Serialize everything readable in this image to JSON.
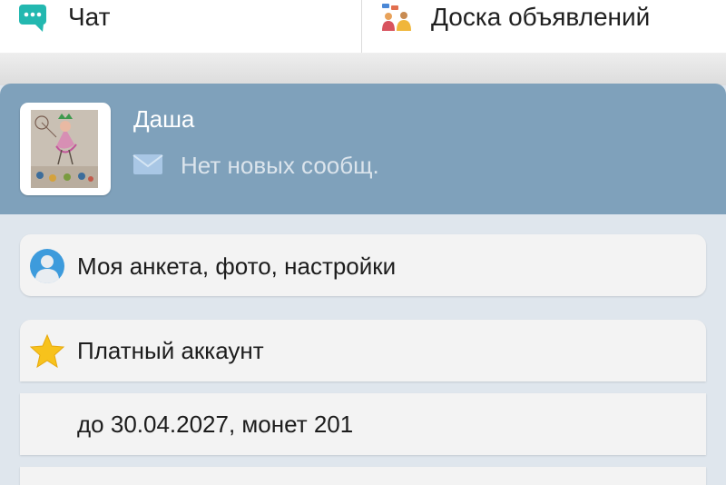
{
  "tabs": {
    "chat": {
      "label": "Чат",
      "icon": "chat-bubble-icon"
    },
    "board": {
      "label": "Доска объявлений",
      "icon": "bulletin-board-icon"
    }
  },
  "profile": {
    "name": "Даша",
    "message_status": "Нет новых сообщ.",
    "message_icon": "envelope-icon",
    "avatar": "user-drawing-photo",
    "colors": {
      "header_bg": "#7fa1bb",
      "name": "#ffffff",
      "message": "#dbe4ec"
    }
  },
  "menu": {
    "anketa": {
      "label": "Моя анкета, фото, настройки",
      "icon": "user-avatar-icon"
    },
    "paid": {
      "label": "Платный аккаунт",
      "icon": "star-icon"
    },
    "paid_details": "до 30.04.2027, монет 201"
  }
}
